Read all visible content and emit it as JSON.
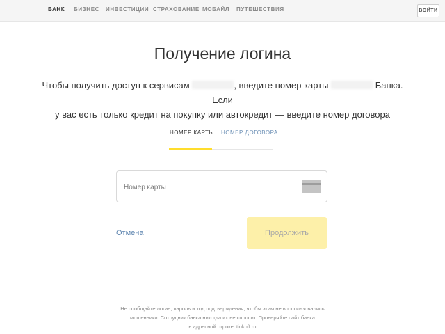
{
  "nav": {
    "items": [
      "БАНК",
      "БИЗНЕС",
      "ИНВЕСТИЦИИ",
      "СТРАХОВАНИЕ",
      "МОБАЙЛ",
      "ПУТЕШЕСТВИЯ"
    ],
    "active_index": 0,
    "login_label": "ВОЙТИ"
  },
  "page": {
    "title": "Получение логина",
    "desc_part1": "Чтобы получить доступ к сервисам",
    "desc_part2": ", введите номер карты",
    "desc_part3": "Банка. Если",
    "desc_line2": "у вас есть только кредит на покупку или автокредит — введите номер договора"
  },
  "tabs": {
    "card": "НОМЕР КАРТЫ",
    "contract": "НОМЕР ДОГОВОРА",
    "active": "card"
  },
  "form": {
    "card_placeholder": "Номер карты",
    "cancel_label": "Отмена",
    "continue_label": "Продолжить"
  },
  "footer": {
    "line1": "Не сообщайте логин, пароль и код подтверждения, чтобы этим не воспользовались",
    "line2": "мошенники. Сотрудник банка никогда их не спросит. Проверяйте сайт банка",
    "line3": "в адресной строке: tinkoff.ru"
  },
  "colors": {
    "accent": "#ffdd2d",
    "button_disabled": "#fdf0a9",
    "link": "#5f86b0"
  }
}
